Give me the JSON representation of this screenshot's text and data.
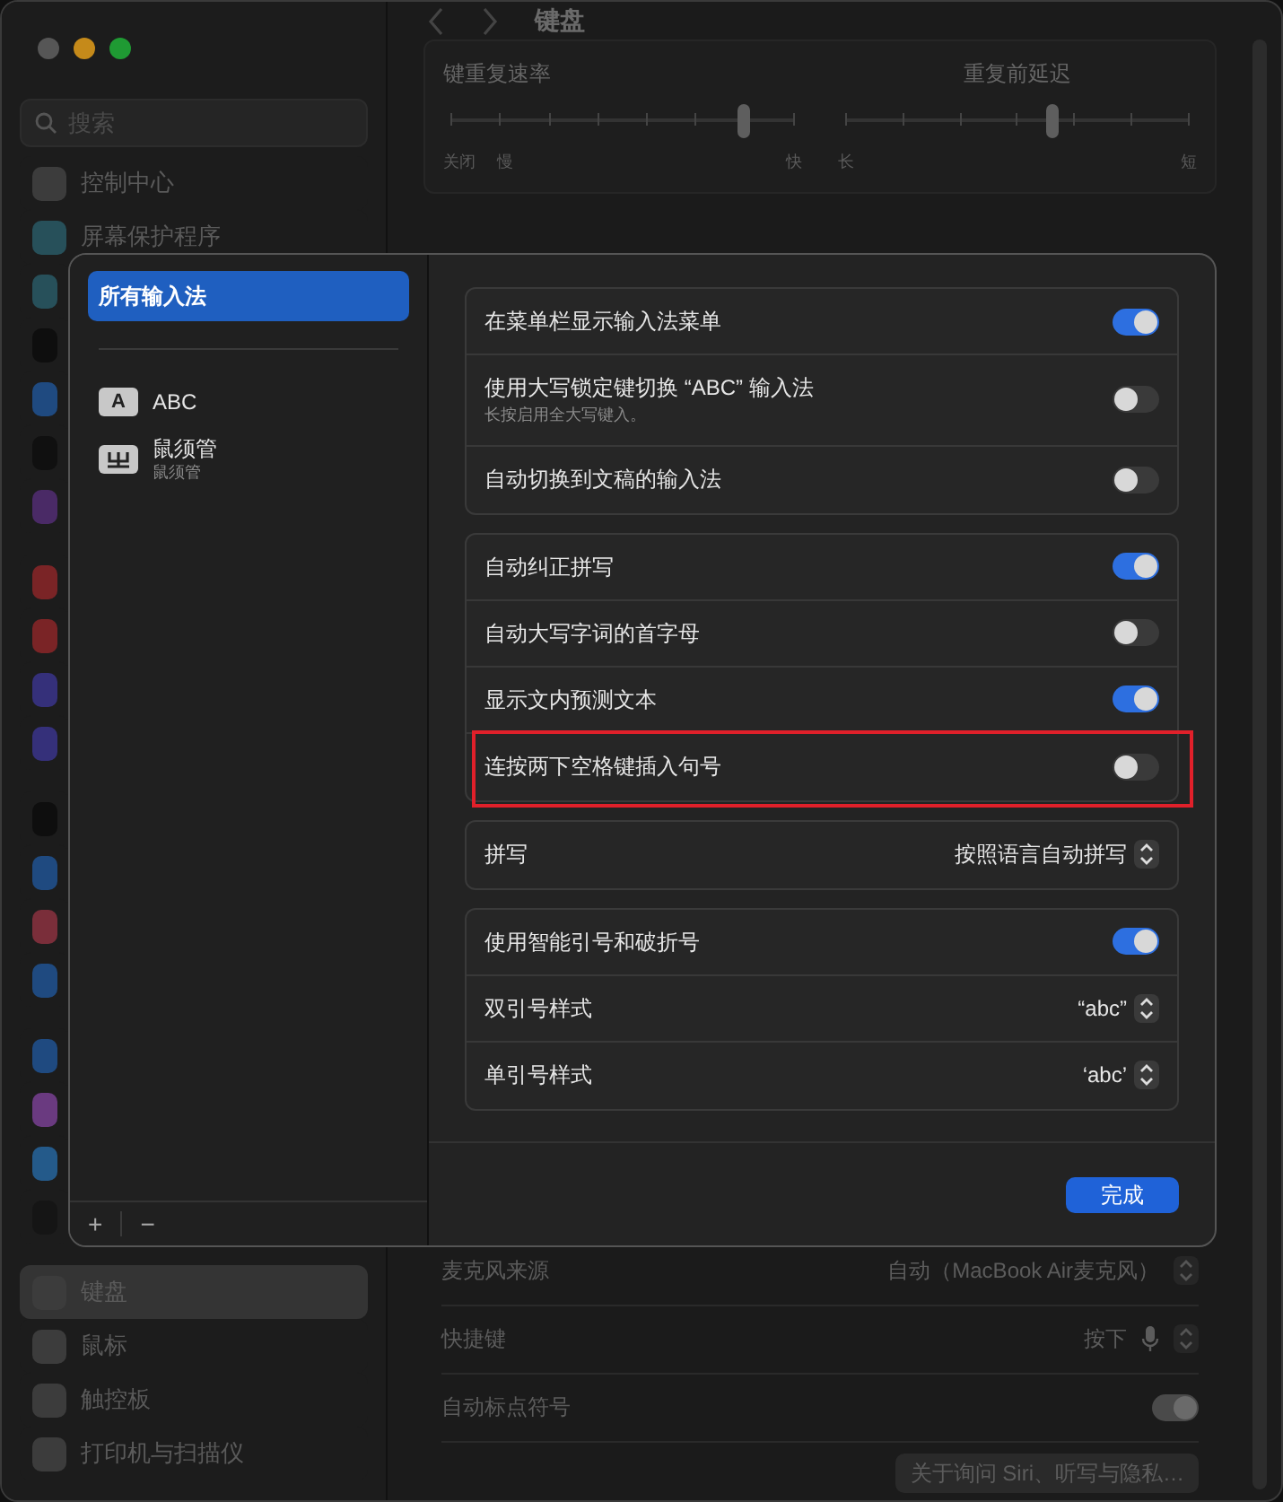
{
  "window": {
    "title": "键盘"
  },
  "sidebar": {
    "search": {
      "placeholder": "搜索"
    },
    "groups": [
      [
        {
          "label": "控制中心",
          "color": "#3c3c3c",
          "selected": false
        },
        {
          "label": "屏幕保护程序",
          "color": "#27505a",
          "selected": false
        },
        {
          "color": "#27505a",
          "selected": false
        },
        {
          "color": "#0e0e0e",
          "selected": false
        },
        {
          "color": "#1f4a80",
          "selected": false
        },
        {
          "color": "#101010",
          "selected": false
        },
        {
          "color": "#4a2a66",
          "selected": false
        }
      ],
      [
        {
          "color": "#7a2426",
          "selected": false
        },
        {
          "color": "#7a2426",
          "selected": false
        },
        {
          "color": "#35307a",
          "selected": false
        },
        {
          "color": "#35307a",
          "selected": false
        }
      ],
      [
        {
          "color": "#0e0e0e",
          "selected": false
        },
        {
          "color": "#1f4a80",
          "selected": false
        },
        {
          "color": "#7a2e3a",
          "selected": false
        },
        {
          "color": "#1f4a80",
          "selected": false
        }
      ],
      [
        {
          "color": "#1f4a80",
          "selected": false
        },
        {
          "color": "#6a3a80",
          "selected": false
        },
        {
          "color": "#245a8a",
          "selected": false
        },
        {
          "color": "#151515",
          "selected": false
        }
      ],
      [
        {
          "label": "键盘",
          "color": "#3c3c3c",
          "selected": true
        },
        {
          "label": "鼠标",
          "color": "#3c3c3c",
          "selected": false
        },
        {
          "label": "触控板",
          "color": "#3c3c3c",
          "selected": false
        },
        {
          "label": "打印机与扫描仪",
          "color": "#3c3c3c",
          "selected": false
        }
      ]
    ]
  },
  "sliders": [
    {
      "title": "键重复速率",
      "level": 0.85,
      "labels": [
        "关闭",
        "慢",
        "快"
      ]
    },
    {
      "title": "重复前延迟",
      "level": 0.6,
      "labels": [
        "长",
        "短"
      ]
    }
  ],
  "rows": [
    {
      "kind": "popup",
      "label": "麦克风来源",
      "value": "自动（MacBook Air麦克风）"
    },
    {
      "kind": "shortcut",
      "label": "快捷键",
      "value": "按下"
    },
    {
      "kind": "toggle",
      "label": "自动标点符号",
      "on": true
    }
  ],
  "privacy_button": "关于询问 Siri、听写与隐私…",
  "sheet": {
    "sources": [
      {
        "label": "所有输入法",
        "selected": true
      },
      {
        "label": "ABC",
        "badge": "A",
        "selected": false
      },
      {
        "label": "鼠须管",
        "subtitle": "鼠须管",
        "selected": false
      }
    ],
    "footer_buttons": [
      "+",
      "−"
    ],
    "groups": [
      [
        {
          "kind": "toggle",
          "label": "在菜单栏显示输入法菜单",
          "on": true,
          "highlighted": false
        },
        {
          "kind": "toggle",
          "label": "使用大写锁定键切换 “ABC” 输入法",
          "note": "长按启用全大写键入。",
          "on": false,
          "highlighted": false
        },
        {
          "kind": "toggle",
          "label": "自动切换到文稿的输入法",
          "on": false,
          "highlighted": false
        }
      ],
      [
        {
          "kind": "toggle",
          "label": "自动纠正拼写",
          "on": true,
          "highlighted": false
        },
        {
          "kind": "toggle",
          "label": "自动大写字词的首字母",
          "on": false,
          "highlighted": false
        },
        {
          "kind": "toggle",
          "label": "显示文内预测文本",
          "on": true,
          "highlighted": false
        },
        {
          "kind": "toggle",
          "label": "连按两下空格键插入句号",
          "on": false,
          "highlighted": true
        }
      ],
      [
        {
          "kind": "popup",
          "label": "拼写",
          "value": "按照语言自动拼写",
          "highlighted": false
        }
      ],
      [
        {
          "kind": "toggle",
          "label": "使用智能引号和破折号",
          "on": true,
          "highlighted": false
        },
        {
          "kind": "popup",
          "label": "双引号样式",
          "value": "“abc”",
          "highlighted": false
        },
        {
          "kind": "popup",
          "label": "单引号样式",
          "value": "‘abc’",
          "highlighted": false
        }
      ]
    ],
    "done_button": "完成"
  }
}
